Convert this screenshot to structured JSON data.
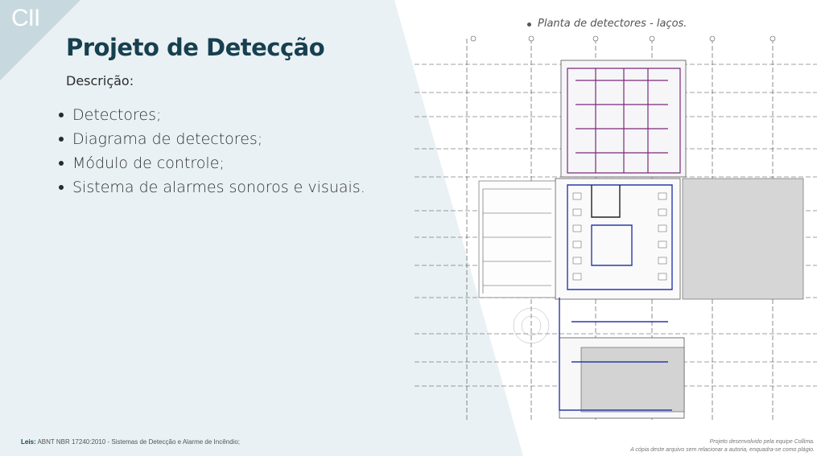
{
  "logo": "CII",
  "title": "Projeto de Detecção",
  "subtitle": "Descrição:",
  "bullets": [
    "Detectores;",
    "Diagrama de detectores;",
    "Módulo de controle;",
    "Sistema de alarmes sonoros e visuais."
  ],
  "plan_caption": "Planta de detectores - laços.",
  "footer": {
    "leis_label": "Leis:",
    "leis_text": "ABNT NBR 17240:2010 - Sistemas de Detecção e Alarme de Incêndio;",
    "credit_line1": "Projeto desenvolvido pela equipe Collima.",
    "credit_line2": "A cópia deste arquivo sem relacionar a autoria, enquadra-se como plágio."
  },
  "colors": {
    "title": "#173f4f",
    "background": "#e9f1f4",
    "loop_purple": "#7a2a7a",
    "loop_blue": "#2a3aa8"
  }
}
